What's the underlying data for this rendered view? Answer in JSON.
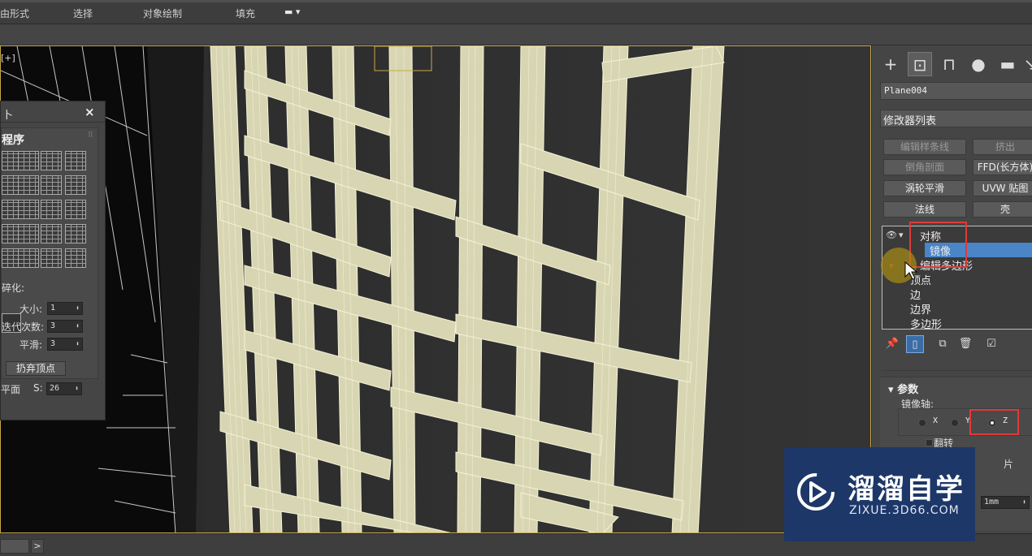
{
  "ribbon": {
    "tabs": [
      "由形式",
      "选择",
      "对象绘制",
      "填充"
    ]
  },
  "viewport": {
    "label": "[+]"
  },
  "float_panel": {
    "title": "卜",
    "section_title": "程序",
    "subdivide_label": "碎化:",
    "size_label": "大小:",
    "size_value": "1",
    "iterations_label": "迭代次数:",
    "iterations_value": "3",
    "smooth_label": "平滑:",
    "smooth_value": "3",
    "discard_button": "扔弃顶点",
    "plane_label": "平面",
    "s_label": "S:",
    "s_value": "26"
  },
  "command_panel": {
    "object_name": "Plane004",
    "modifier_list": "修改器列表",
    "modifier_buttons": [
      {
        "label": "编辑样条线",
        "dim": true
      },
      {
        "label": "挤出",
        "dim": true
      },
      {
        "label": "倒角剖面",
        "dim": true
      },
      {
        "label": "FFD(长方体)",
        "dim": false
      },
      {
        "label": "涡轮平滑",
        "dim": false
      },
      {
        "label": "UVW 贴图",
        "dim": false
      },
      {
        "label": "法线",
        "dim": false
      },
      {
        "label": "壳",
        "dim": false
      }
    ],
    "stack": {
      "symmetry": "对称",
      "mirror": "镜像",
      "edit_poly": "编辑多边形",
      "vertex": "顶点",
      "edge": "边",
      "border": "边界",
      "polygon": "多边形"
    },
    "params": {
      "title": "参数",
      "mirror_axis_label": "镜像轴:",
      "axis_x": "X",
      "axis_y": "Y",
      "axis_z": "Z",
      "selected_axis": "Z",
      "flip_label": "翻转",
      "partial_label": "片",
      "threshold_value": "1mm"
    }
  },
  "watermark": {
    "title": "溜溜自学",
    "url": "ZIXUE.3D66.COM"
  },
  "colors": {
    "viewport_frame": "#c8a84a",
    "highlight": "#e03a3a",
    "selection": "#4a85c8",
    "watermark_bg": "#1d3768",
    "mesh": "#d8d6b2"
  }
}
